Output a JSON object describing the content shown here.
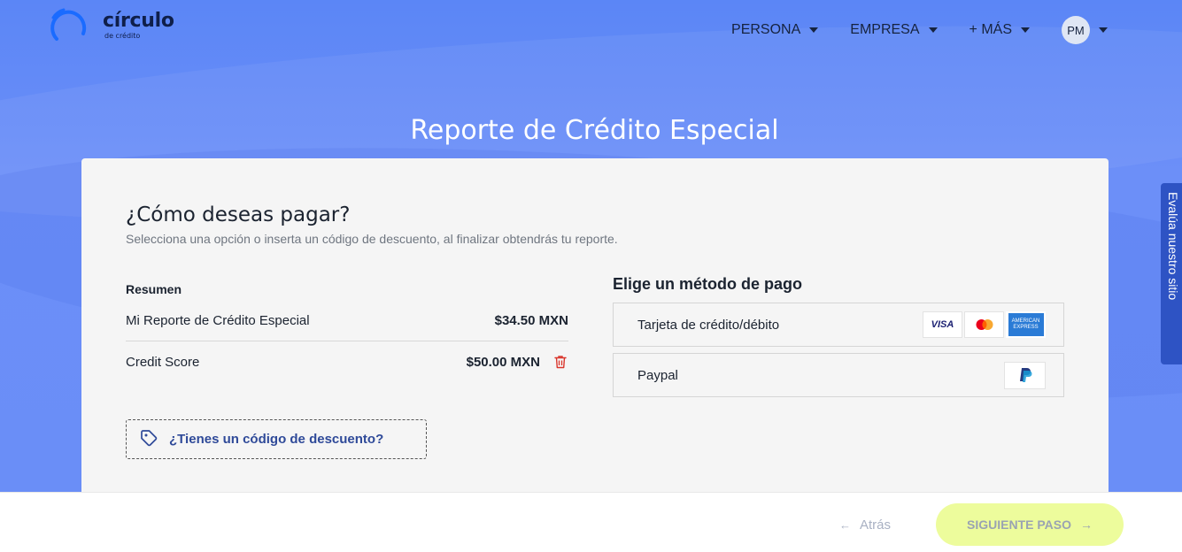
{
  "header": {
    "logo_main": "círculo",
    "logo_sub": "de crédito",
    "nav": [
      {
        "label": "PERSONA"
      },
      {
        "label": "EMPRESA"
      },
      {
        "label": "+ MÁS"
      }
    ],
    "user_initials": "PM"
  },
  "page_title": "Reporte de Crédito Especial",
  "payment": {
    "heading": "¿Cómo deseas pagar?",
    "subheading": "Selecciona una opción o inserta un código de descuento, al finalizar obtendrás tu reporte.",
    "summary": {
      "title": "Resumen",
      "items": [
        {
          "name": "Mi Reporte de Crédito Especial",
          "price": "$34.50 MXN"
        },
        {
          "name": "Credit Score",
          "price": "$50.00 MXN"
        }
      ]
    },
    "discount_label": "¿Tienes un código de descuento?",
    "methods_title": "Elige un método de pago",
    "methods": [
      {
        "name": "Tarjeta de crédito/débito",
        "badges": [
          "VISA",
          "Mastercard",
          "AMERICAN EXPRESS"
        ]
      },
      {
        "name": "Paypal",
        "badges": [
          "PayPal"
        ]
      }
    ]
  },
  "side_tab": {
    "label": "Evalúa nuestro sitio"
  },
  "footer": {
    "back_label": "Atrás",
    "next_label": "SIGUIENTE PASO"
  },
  "colors": {
    "hero": "#6a8ef7",
    "card": "#f5f5f5",
    "accent_link": "#2f4a99",
    "next_button": "#edfc9c",
    "side_tab": "#2e53c4",
    "trash": "#d9352b"
  },
  "icons": {
    "caret": "caret-down-icon",
    "trash": "trash-icon",
    "tag": "tag-icon",
    "back": "arrow-left-icon",
    "next": "arrow-right-icon",
    "feedback": "feedback-icon"
  }
}
